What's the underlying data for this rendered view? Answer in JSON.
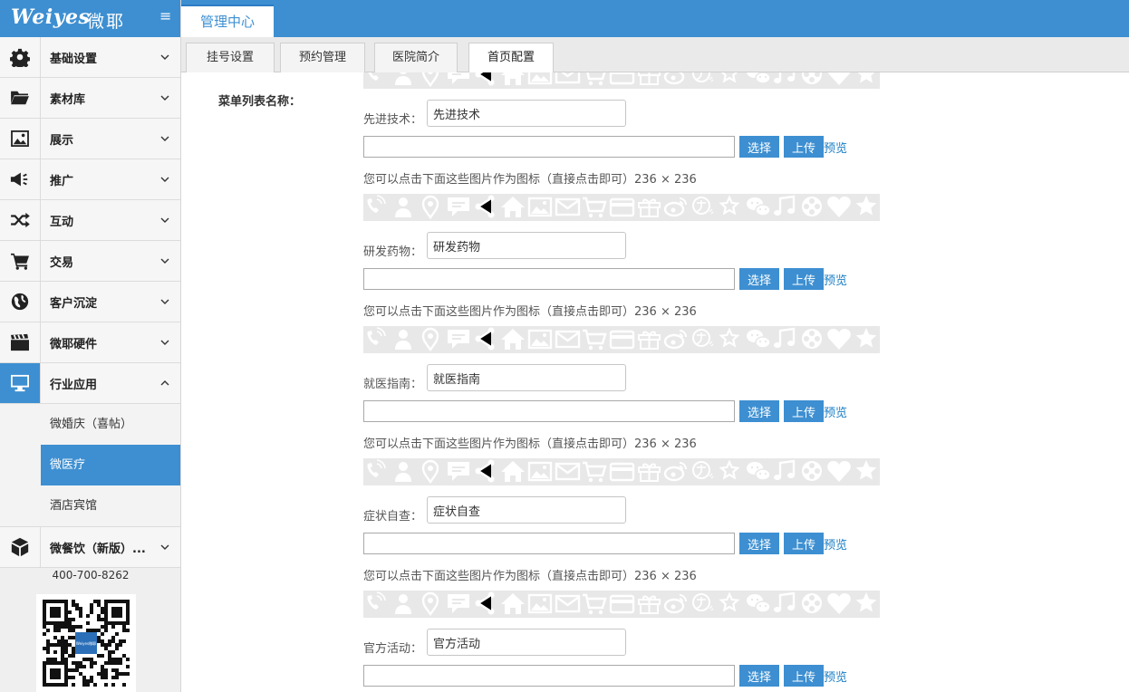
{
  "sidebar": {
    "brand_latin": "Weiyes",
    "brand_cn": "微耶",
    "items": [
      {
        "label": "基础设置",
        "icon": "gear-icon"
      },
      {
        "label": "素材库",
        "icon": "folder-icon"
      },
      {
        "label": "展示",
        "icon": "image-icon"
      },
      {
        "label": "推广",
        "icon": "megaphone-icon"
      },
      {
        "label": "互动",
        "icon": "shuffle-icon"
      },
      {
        "label": "交易",
        "icon": "cart-icon"
      },
      {
        "label": "客户沉淀",
        "icon": "globe-icon"
      },
      {
        "label": "微耶硬件",
        "icon": "clapperboard-icon"
      },
      {
        "label": "行业应用",
        "icon": "monitor-icon"
      }
    ],
    "sub_items": [
      {
        "label": "微婚庆（喜帖）"
      },
      {
        "label": "微医疗"
      },
      {
        "label": "酒店宾馆"
      }
    ],
    "last_item": {
      "label": "微餐饮（新版）...",
      "icon": "box-icon"
    },
    "phone": "400-700-8262",
    "qr_center": "Weiyes微耶"
  },
  "topbar": {
    "tab": "管理中心"
  },
  "tabs": [
    "挂号设置",
    "预约管理",
    "医院简介",
    "首页配置"
  ],
  "content": {
    "section_label": "菜单列表名称：",
    "choose_label": "选择",
    "upload_label": "上传",
    "preview_label": "预览",
    "hint": "您可以点击下面这些图片作为图标（直接点击即可）236 × 236",
    "entries": [
      {
        "label": "先进技术：",
        "value": "先进技术"
      },
      {
        "label": "研发药物：",
        "value": "研发药物"
      },
      {
        "label": "就医指南：",
        "value": "就医指南"
      },
      {
        "label": "症状自查：",
        "value": "症状自查"
      },
      {
        "label": "官方活动：",
        "value": "官方活动"
      }
    ]
  },
  "colors": {
    "accent": "#3d8fd1",
    "link": "#1a7ec4",
    "strip_bg": "#e8e8e8"
  }
}
